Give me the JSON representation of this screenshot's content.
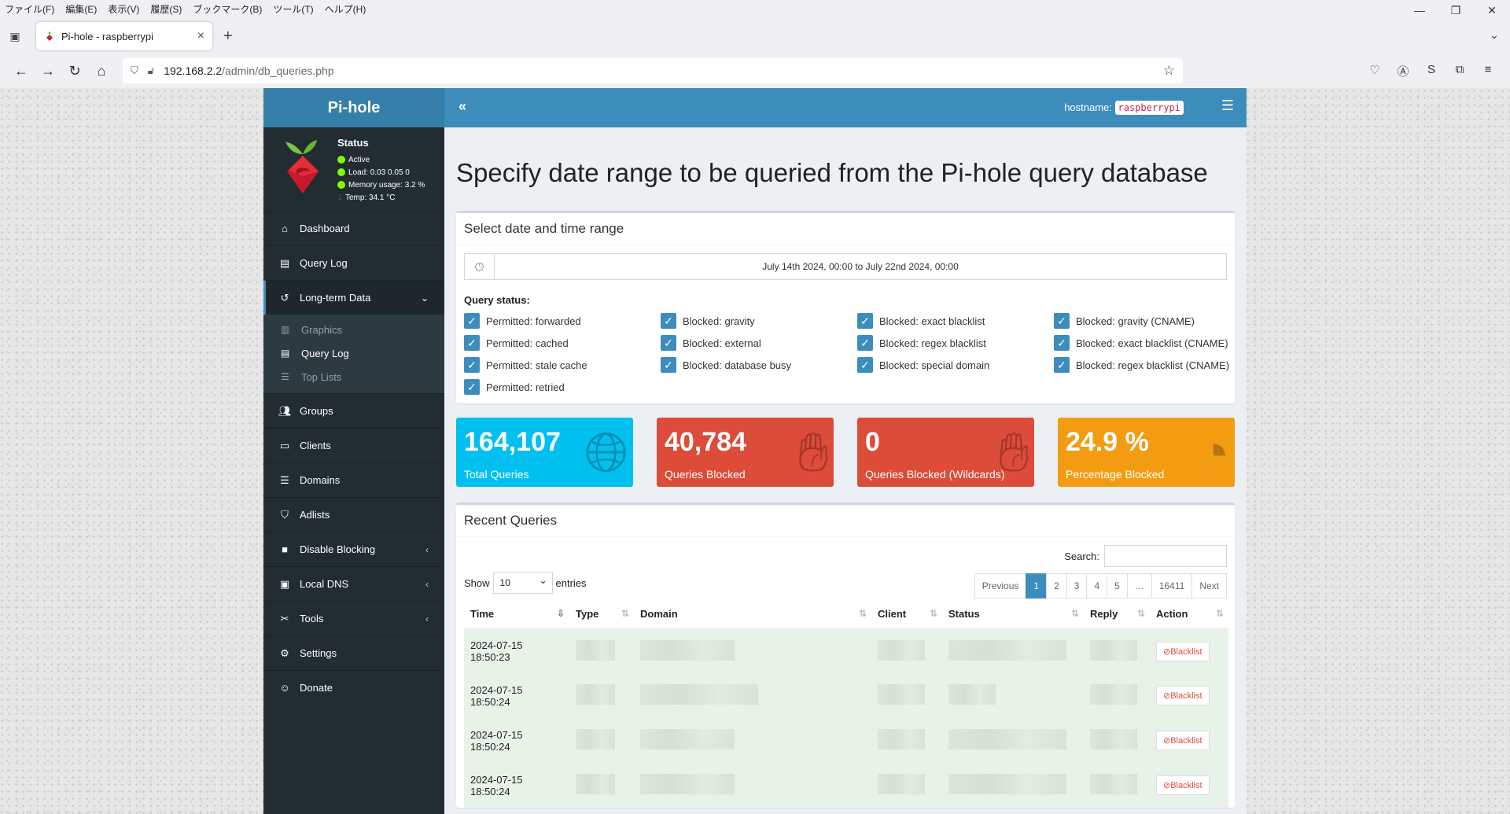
{
  "browser": {
    "menu": [
      "ファイル(F)",
      "編集(E)",
      "表示(V)",
      "履歴(S)",
      "ブックマーク(B)",
      "ツール(T)",
      "ヘルプ(H)"
    ],
    "tab_title": "Pi-hole - raspberrypi",
    "url_host": "192.168.2.2",
    "url_path": "/admin/db_queries.php"
  },
  "sidebar": {
    "brand": "Pi-hole",
    "status_title": "Status",
    "status_active": "Active",
    "status_load": "Load:  0.03  0.05  0",
    "status_memory": "Memory usage:  3.2 %",
    "status_temp": "Temp: 34.1 °C",
    "items": [
      {
        "label": "Dashboard",
        "icon": "home-icon"
      },
      {
        "label": "Query Log",
        "icon": "file-icon"
      },
      {
        "label": "Long-term Data",
        "icon": "history-icon"
      },
      {
        "label": "Groups",
        "icon": "users-icon"
      },
      {
        "label": "Clients",
        "icon": "laptop-icon"
      },
      {
        "label": "Domains",
        "icon": "list-icon"
      },
      {
        "label": "Adlists",
        "icon": "shield-icon"
      },
      {
        "label": "Disable Blocking",
        "icon": "stop-icon"
      },
      {
        "label": "Local DNS",
        "icon": "address-book-icon"
      },
      {
        "label": "Tools",
        "icon": "tools-icon"
      },
      {
        "label": "Settings",
        "icon": "gear-icon"
      },
      {
        "label": "Donate",
        "icon": "donate-icon"
      }
    ],
    "sub_items": [
      {
        "label": "Graphics",
        "icon": "chart-icon"
      },
      {
        "label": "Query Log",
        "icon": "file-icon"
      },
      {
        "label": "Top Lists",
        "icon": "list-icon"
      }
    ]
  },
  "header": {
    "hostname_label": "hostname:",
    "hostname": "raspberrypi"
  },
  "main": {
    "title": "Specify date range to be queried from the Pi-hole query database",
    "range_box_title": "Select date and time range",
    "date_range": "July 14th 2024, 00:00 to July 22nd 2024, 00:00",
    "query_status_label": "Query status:",
    "checkboxes": [
      "Permitted: forwarded",
      "Blocked: gravity",
      "Blocked: exact blacklist",
      "Blocked: gravity (CNAME)",
      "Permitted: cached",
      "Blocked: external",
      "Blocked: regex blacklist",
      "Blocked: exact blacklist (CNAME)",
      "Permitted: stale cache",
      "Blocked: database busy",
      "Blocked: special domain",
      "Blocked: regex blacklist (CNAME)",
      "Permitted: retried"
    ],
    "stats": [
      {
        "value": "164,107",
        "label": "Total Queries",
        "color": "#00c0ef",
        "icon": "globe-icon"
      },
      {
        "value": "40,784",
        "label": "Queries Blocked",
        "color": "#dd4b39",
        "icon": "hand-icon"
      },
      {
        "value": "0",
        "label": "Queries Blocked (Wildcards)",
        "color": "#dd4b39",
        "icon": "hand-icon"
      },
      {
        "value": "24.9 %",
        "label": "Percentage Blocked",
        "color": "#f39c12",
        "icon": "pie-chart-icon"
      }
    ],
    "recent_title": "Recent Queries",
    "search_label": "Search:",
    "show_label": "Show",
    "entries_value": "10",
    "entries_label": "entries",
    "pagination": [
      "Previous",
      "1",
      "2",
      "3",
      "4",
      "5",
      "…",
      "16411",
      "Next"
    ],
    "columns": [
      "Time",
      "Type",
      "Domain",
      "Client",
      "Status",
      "Reply",
      "Action"
    ],
    "rows": [
      {
        "time": "2024-07-15 18:50:23",
        "action": "Blacklist"
      },
      {
        "time": "2024-07-15 18:50:24",
        "action": "Blacklist"
      },
      {
        "time": "2024-07-15 18:50:24",
        "action": "Blacklist"
      },
      {
        "time": "2024-07-15 18:50:24",
        "action": "Blacklist"
      }
    ]
  }
}
